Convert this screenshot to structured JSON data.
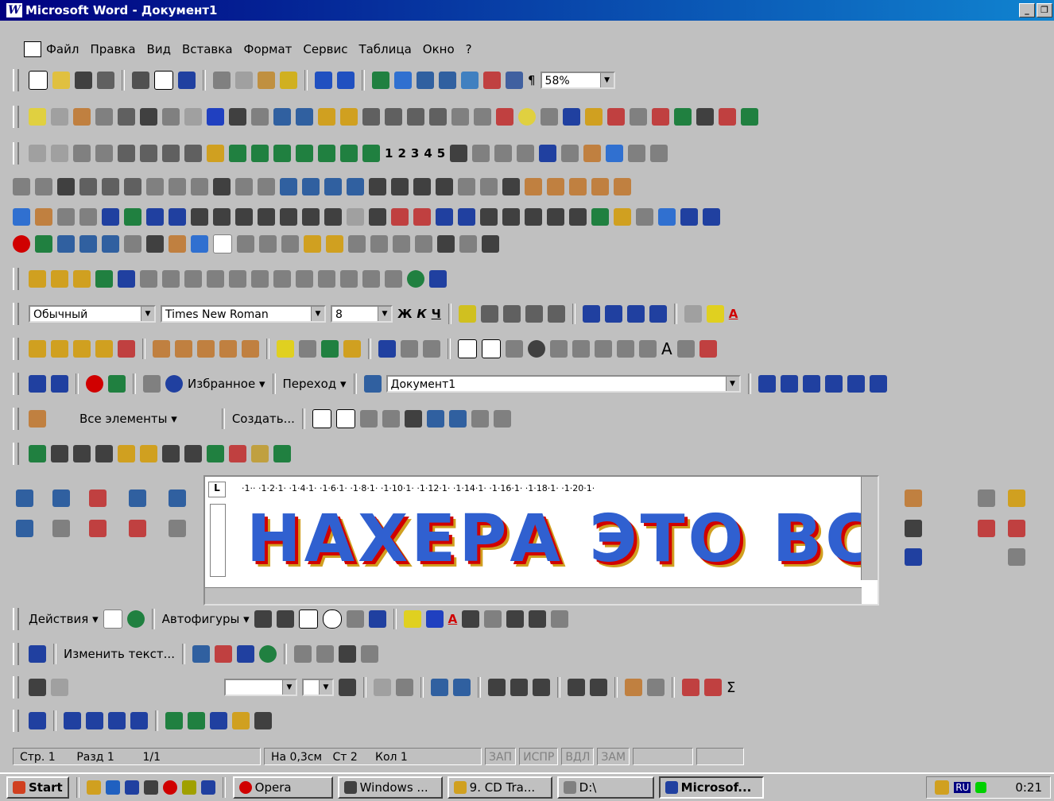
{
  "window": {
    "title": "Microsoft Word - Документ1",
    "logo_letter": "W"
  },
  "menu": [
    "Файл",
    "Правка",
    "Вид",
    "Вставка",
    "Формат",
    "Сервис",
    "Таблица",
    "Окно",
    "?"
  ],
  "standard_toolbar": {
    "zoom": "58%"
  },
  "outline_toolbar": {
    "levels": [
      "1",
      "2",
      "3",
      "4",
      "5"
    ]
  },
  "formatting_toolbar": {
    "style": "Обычный",
    "font": "Times New Roman",
    "size": "8"
  },
  "web_toolbar": {
    "favorites": "Избранное",
    "go": "Переход",
    "address": "Документ1"
  },
  "autotext_toolbar": {
    "all_entries": "Все элементы",
    "create": "Создать..."
  },
  "document": {
    "ruler": "·1·· ·1·2·1· ·1·4·1· ·1·6·1· ·1·8·1· ·1·10·1· ·1·12·1· ·1·14·1· ·1·16·1· ·1·18·1· ·1·20·1·",
    "wordart_text": "НАХЕРА ЭТО ВСЕ ?"
  },
  "drawing_toolbar": {
    "actions": "Действия",
    "autoshapes": "Автофигуры"
  },
  "wordart_toolbar": {
    "edit_text": "Изменить текст..."
  },
  "statusbar": {
    "page": "Стр. 1",
    "section": "Разд 1",
    "pages": "1/1",
    "position": "На 0,3см",
    "line": "Ст 2",
    "column": "Кол 1",
    "rec": "ЗАП",
    "trk": "ИСПР",
    "ext": "ВДЛ",
    "ovr": "ЗАМ"
  },
  "taskbar": {
    "start": "Start",
    "tasks": [
      "Opera",
      "Windows ...",
      "9. CD Tra...",
      "D:\\",
      "Microsof..."
    ],
    "lang": "RU",
    "clock": "0:21"
  },
  "colors": {
    "title_start": "#000080",
    "title_end": "#1084d0",
    "face": "#c0c0c0",
    "wordart_fill": "#3060d0",
    "wordart_shadow": "#d00000"
  }
}
